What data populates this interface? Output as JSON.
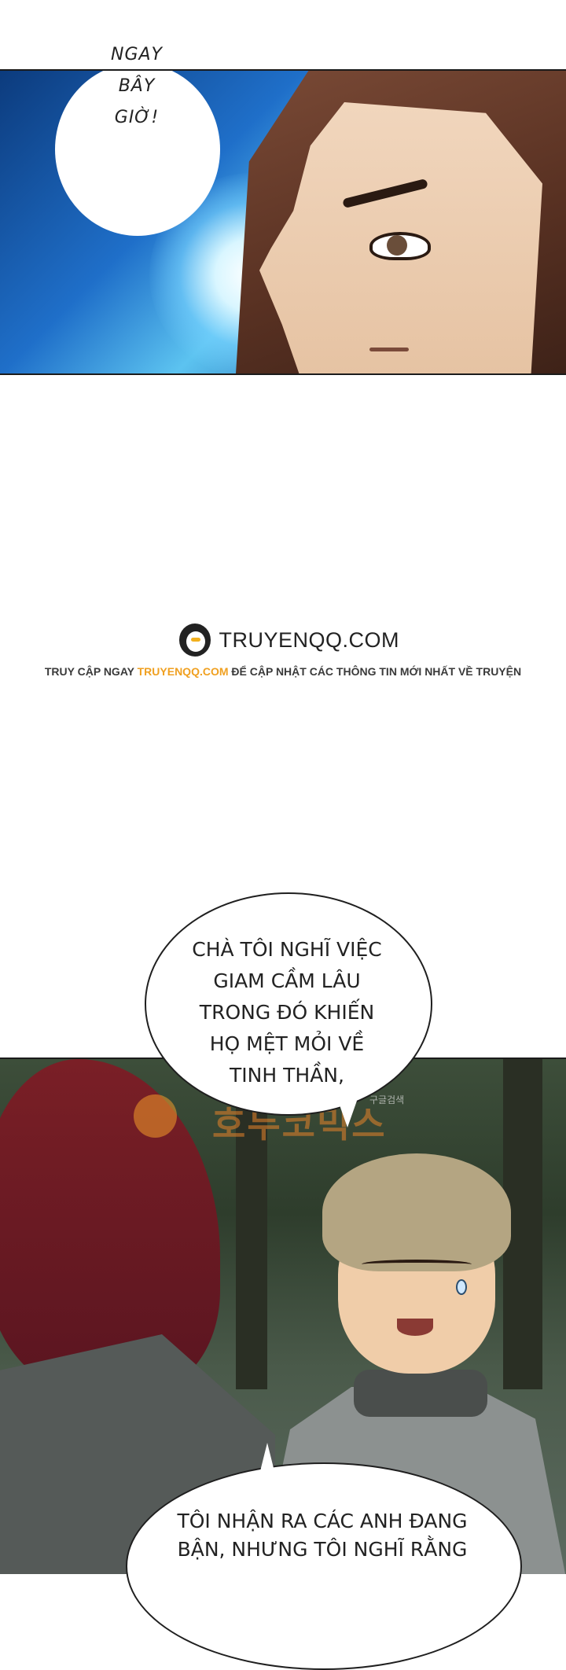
{
  "panel1": {
    "speech": [
      "NGAY",
      "BÂY",
      "GIỜ!"
    ]
  },
  "banner": {
    "logo_text": "TRUYENQQ.COM",
    "notice_prefix": "TRUY CẬP NGAY ",
    "notice_link": "TRUYENQQ.COM",
    "notice_suffix": " ĐỂ CẬP NHẬT CÁC THÔNG TIN MỚI NHẤT VỀ TRUYỆN",
    "icon": "penguin-icon"
  },
  "panel2": {
    "speech_top": [
      "CHÀ TÔI NGHĨ VIỆC",
      "GIAM CẦM LÂU",
      "TRONG ĐÓ KHIẾN",
      "HỌ MỆT MỎI VỀ",
      "TINH THẦN,"
    ],
    "speech_bottom": [
      "TÔI NHẬN RA CÁC ANH ĐANG",
      "BẬN, NHƯNG TÔI NGHĨ RẰNG"
    ],
    "watermark_korean": "호두코믹스",
    "watermark_small": "구글검색"
  },
  "colors": {
    "accent": "#f0a020",
    "ink": "#222222"
  }
}
